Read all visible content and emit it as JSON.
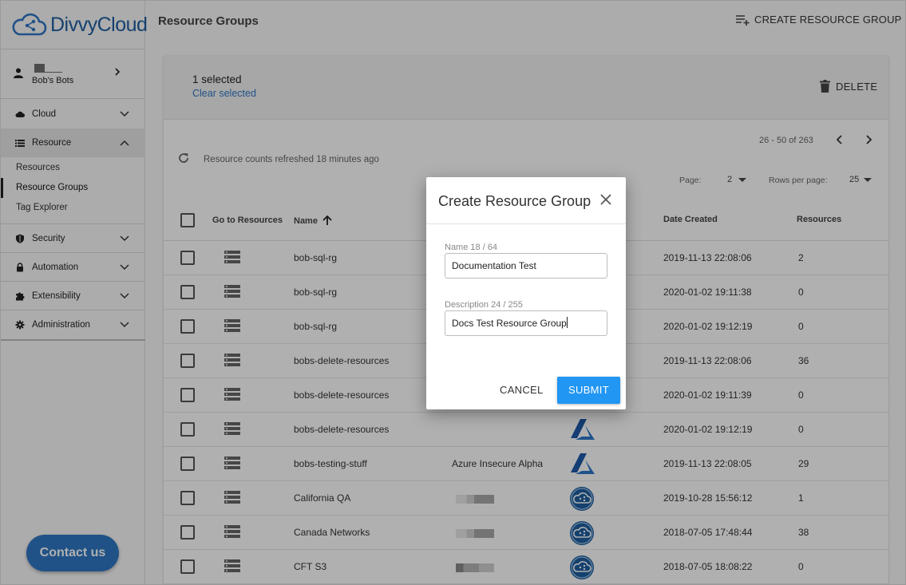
{
  "app": {
    "logo_text": "DivvyCloud",
    "brand_color": "#1f5fa0",
    "accent_color": "#2196f3"
  },
  "user": {
    "org": "Bob's Bots"
  },
  "sidebar": {
    "items": [
      {
        "label": "Cloud",
        "icon": "cloud-icon"
      },
      {
        "label": "Resource",
        "icon": "list-icon"
      },
      {
        "label": "Security",
        "icon": "shield-icon"
      },
      {
        "label": "Automation",
        "icon": "lock-icon"
      },
      {
        "label": "Extensibility",
        "icon": "puzzle-icon"
      },
      {
        "label": "Administration",
        "icon": "gear-icon"
      }
    ],
    "sub_items": [
      "Resources",
      "Resource Groups",
      "Tag Explorer"
    ]
  },
  "contact_label": "Contact us",
  "page": {
    "title": "Resource Groups",
    "create_label": "CREATE RESOURCE GROUP"
  },
  "selection": {
    "count_text": "1 selected",
    "clear_text": "Clear selected",
    "delete_label": "DELETE"
  },
  "pagination": {
    "range": "26 - 50 of 263",
    "page_label": "Page:",
    "page_value": "2",
    "rows_label": "Rows per page:",
    "rows_value": "25"
  },
  "refresh_text": "Resource counts refreshed 18 minutes ago",
  "table": {
    "headers": {
      "goto": "Go to Resources",
      "name": "Name",
      "date": "Date Created",
      "resources": "Resources"
    },
    "rows": [
      {
        "name": "bob-sql-rg",
        "account": "",
        "provider": "",
        "date": "2019-11-13 22:08:06",
        "resources": "2"
      },
      {
        "name": "bob-sql-rg",
        "account": "",
        "provider": "",
        "date": "2020-01-02 19:11:38",
        "resources": "0"
      },
      {
        "name": "bob-sql-rg",
        "account": "",
        "provider": "",
        "date": "2020-01-02 19:12:19",
        "resources": "0"
      },
      {
        "name": "bobs-delete-resources",
        "account": "",
        "provider": "",
        "date": "2019-11-13 22:08:06",
        "resources": "36"
      },
      {
        "name": "bobs-delete-resources",
        "account": "",
        "provider": "",
        "date": "2020-01-02 19:11:39",
        "resources": "0"
      },
      {
        "name": "bobs-delete-resources",
        "account": "",
        "provider": "azure",
        "date": "2020-01-02 19:12:19",
        "resources": "0"
      },
      {
        "name": "bobs-testing-stuff",
        "account": "Azure Insecure Alpha",
        "provider": "azure",
        "date": "2019-11-13 22:08:05",
        "resources": "29"
      },
      {
        "name": "California QA",
        "account": "",
        "provider": "divvy",
        "date": "2019-10-28 15:56:12",
        "resources": "1"
      },
      {
        "name": "Canada Networks",
        "account": "",
        "provider": "divvy",
        "date": "2018-07-05 17:48:44",
        "resources": "38"
      },
      {
        "name": "CFT S3",
        "account": "",
        "provider": "divvy",
        "date": "2018-07-05 18:08:22",
        "resources": "0"
      }
    ]
  },
  "dialog": {
    "title": "Create Resource Group",
    "name_label": "Name 18 / 64",
    "name_value": "Documentation Test",
    "desc_label": "Description 24 / 255",
    "desc_value": "Docs Test Resource Group",
    "cancel_label": "CANCEL",
    "submit_label": "SUBMIT"
  }
}
